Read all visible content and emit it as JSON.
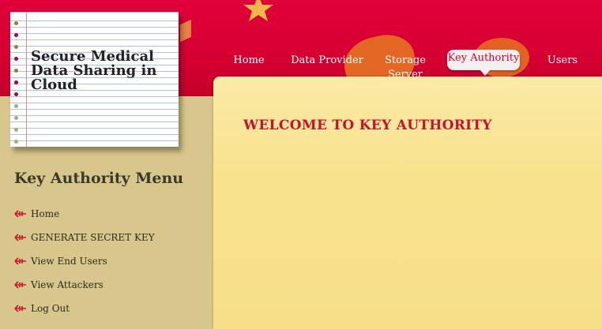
{
  "site": {
    "title": "Secure Medical Data Sharing in Cloud"
  },
  "nav": [
    {
      "label": "Home",
      "active": false
    },
    {
      "label": "Data Provider",
      "active": false
    },
    {
      "label": "Storage Server",
      "active": false
    },
    {
      "label": "Key Authority",
      "active": true
    },
    {
      "label": "Users",
      "active": false
    }
  ],
  "main": {
    "heading": "WELCOME TO KEY AUTHORITY"
  },
  "sidebar": {
    "title": "Key Authority Menu",
    "items": [
      {
        "label": "Home",
        "icon": "arrow-bullet-icon"
      },
      {
        "label": "GENERATE SECRET KEY",
        "icon": "arrow-bullet-icon"
      },
      {
        "label": "View End Users",
        "icon": "arrow-bullet-icon"
      },
      {
        "label": "View Attackers",
        "icon": "arrow-bullet-icon"
      },
      {
        "label": "Log Out",
        "icon": "arrow-bullet-icon"
      }
    ]
  },
  "colors": {
    "header": "#d8003a",
    "accent": "#c8102e",
    "sidebar": "#d8c78c",
    "content": "#f8e28d"
  }
}
